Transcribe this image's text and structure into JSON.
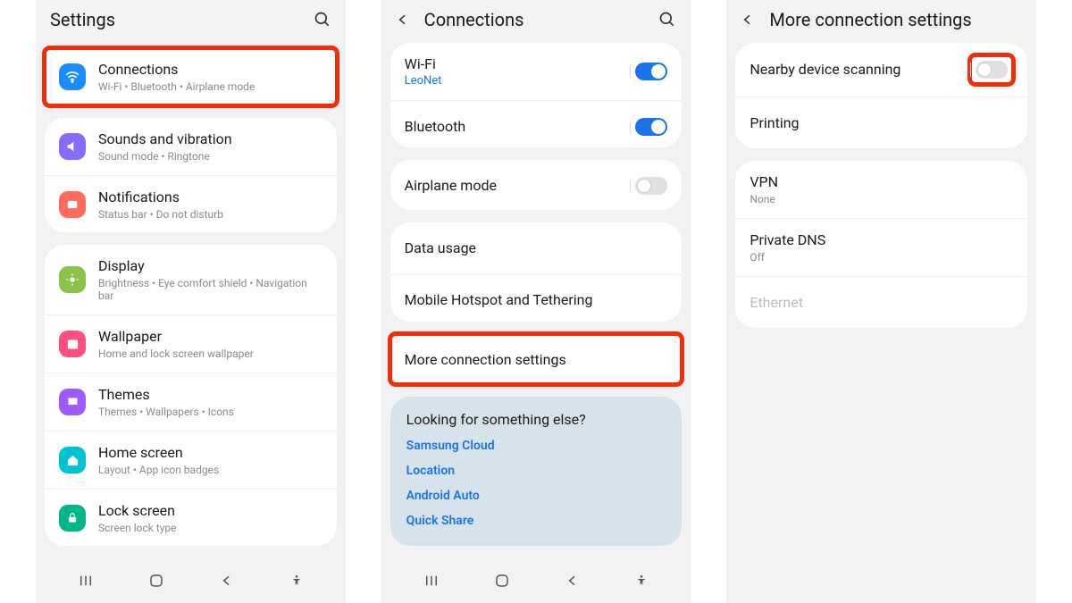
{
  "screen1": {
    "title": "Settings",
    "items": {
      "connections": {
        "title": "Connections",
        "sub": "Wi-Fi  •  Bluetooth  •  Airplane mode"
      },
      "sounds": {
        "title": "Sounds and vibration",
        "sub": "Sound mode  •  Ringtone"
      },
      "notifications": {
        "title": "Notifications",
        "sub": "Status bar  •  Do not disturb"
      },
      "display": {
        "title": "Display",
        "sub": "Brightness  •  Eye comfort shield  •  Navigation bar"
      },
      "wallpaper": {
        "title": "Wallpaper",
        "sub": "Home and lock screen wallpaper"
      },
      "themes": {
        "title": "Themes",
        "sub": "Themes  •  Wallpapers  •  Icons"
      },
      "homescreen": {
        "title": "Home screen",
        "sub": "Layout  •  App icon badges"
      },
      "lockscreen": {
        "title": "Lock screen",
        "sub": "Screen lock type"
      }
    }
  },
  "screen2": {
    "title": "Connections",
    "wifi": {
      "title": "Wi-Fi",
      "sub": "LeoNet"
    },
    "bluetooth": {
      "title": "Bluetooth"
    },
    "airplane": {
      "title": "Airplane mode"
    },
    "datausage": {
      "title": "Data usage"
    },
    "hotspot": {
      "title": "Mobile Hotspot and Tethering"
    },
    "more": {
      "title": "More connection settings"
    },
    "suggest": {
      "heading": "Looking for something else?",
      "links": [
        "Samsung Cloud",
        "Location",
        "Android Auto",
        "Quick Share"
      ]
    }
  },
  "screen3": {
    "title": "More connection settings",
    "nearby": {
      "title": "Nearby device scanning"
    },
    "printing": {
      "title": "Printing"
    },
    "vpn": {
      "title": "VPN",
      "sub": "None"
    },
    "privdns": {
      "title": "Private DNS",
      "sub": "Off"
    },
    "ethernet": {
      "title": "Ethernet"
    }
  }
}
